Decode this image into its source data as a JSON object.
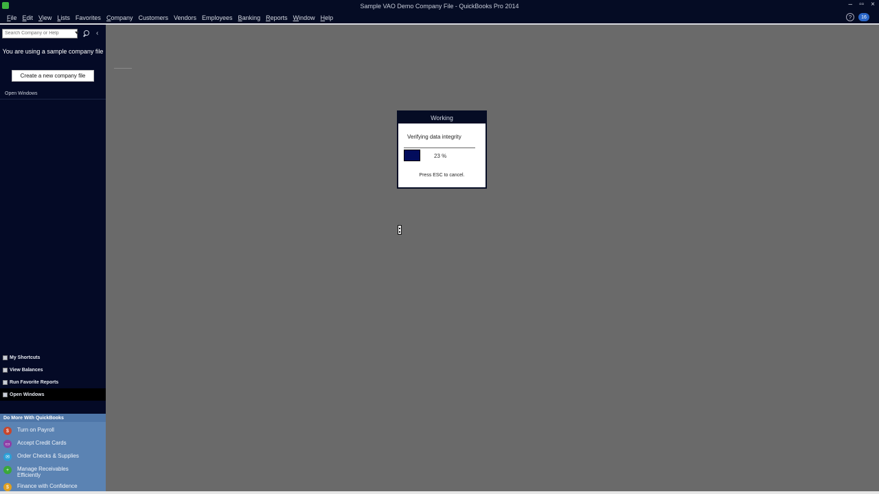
{
  "window": {
    "title": "Sample VAO Demo Company File - QuickBooks Pro 2014",
    "controls": [
      "–",
      "▫▫",
      "×"
    ]
  },
  "menu": {
    "items": [
      {
        "key": "F",
        "rest": "ile"
      },
      {
        "key": "E",
        "rest": "dit"
      },
      {
        "key": "V",
        "rest": "iew"
      },
      {
        "key": "L",
        "rest": "ists"
      },
      {
        "key": "",
        "rest": "Favorites"
      },
      {
        "key": "C",
        "rest": "ompany"
      },
      {
        "key": "",
        "rest": "Customers"
      },
      {
        "key": "",
        "rest": "Vendors"
      },
      {
        "key": "",
        "rest": "Employees"
      },
      {
        "key": "B",
        "rest": "anking"
      },
      {
        "key": "R",
        "rest": "eports"
      },
      {
        "key": "W",
        "rest": "indow"
      },
      {
        "key": "H",
        "rest": "elp"
      }
    ],
    "help_glyph": "?",
    "badge_text": "16"
  },
  "sidebar": {
    "search_placeholder": "Search Company or Help",
    "collapse_glyph": "‹",
    "sample_note": "You are using a sample company file",
    "create_button": "Create a new company file",
    "open_windows_header": "Open Windows",
    "nav": [
      {
        "label": "My Shortcuts",
        "active": false
      },
      {
        "label": "View Balances",
        "active": false
      },
      {
        "label": "Run Favorite Reports",
        "active": false
      },
      {
        "label": "Open Windows",
        "active": true
      }
    ],
    "do_more_header": "Do More With QuickBooks",
    "do_more_items": [
      {
        "label": "Turn on Payroll",
        "icon": "payroll-icon",
        "color": "#c8462c",
        "glyph": "$"
      },
      {
        "label": "Accept Credit Cards",
        "icon": "credit-card-icon",
        "color": "#8e3fa8",
        "glyph": "▭"
      },
      {
        "label": "Order Checks & Supplies",
        "icon": "checks-icon",
        "color": "#2aa0d8",
        "glyph": "✉"
      },
      {
        "label": "Manage Receivables Efficiently",
        "icon": "receivables-icon",
        "color": "#3aa83a",
        "glyph": "+"
      },
      {
        "label": "Finance with Confidence",
        "icon": "finance-icon",
        "color": "#e0a020",
        "glyph": "$"
      }
    ]
  },
  "dialog": {
    "title": "Working",
    "message": "Verifying data integrity",
    "progress_percent": 23,
    "progress_label": "23 %",
    "cancel_hint": "Press ESC to cancel."
  }
}
